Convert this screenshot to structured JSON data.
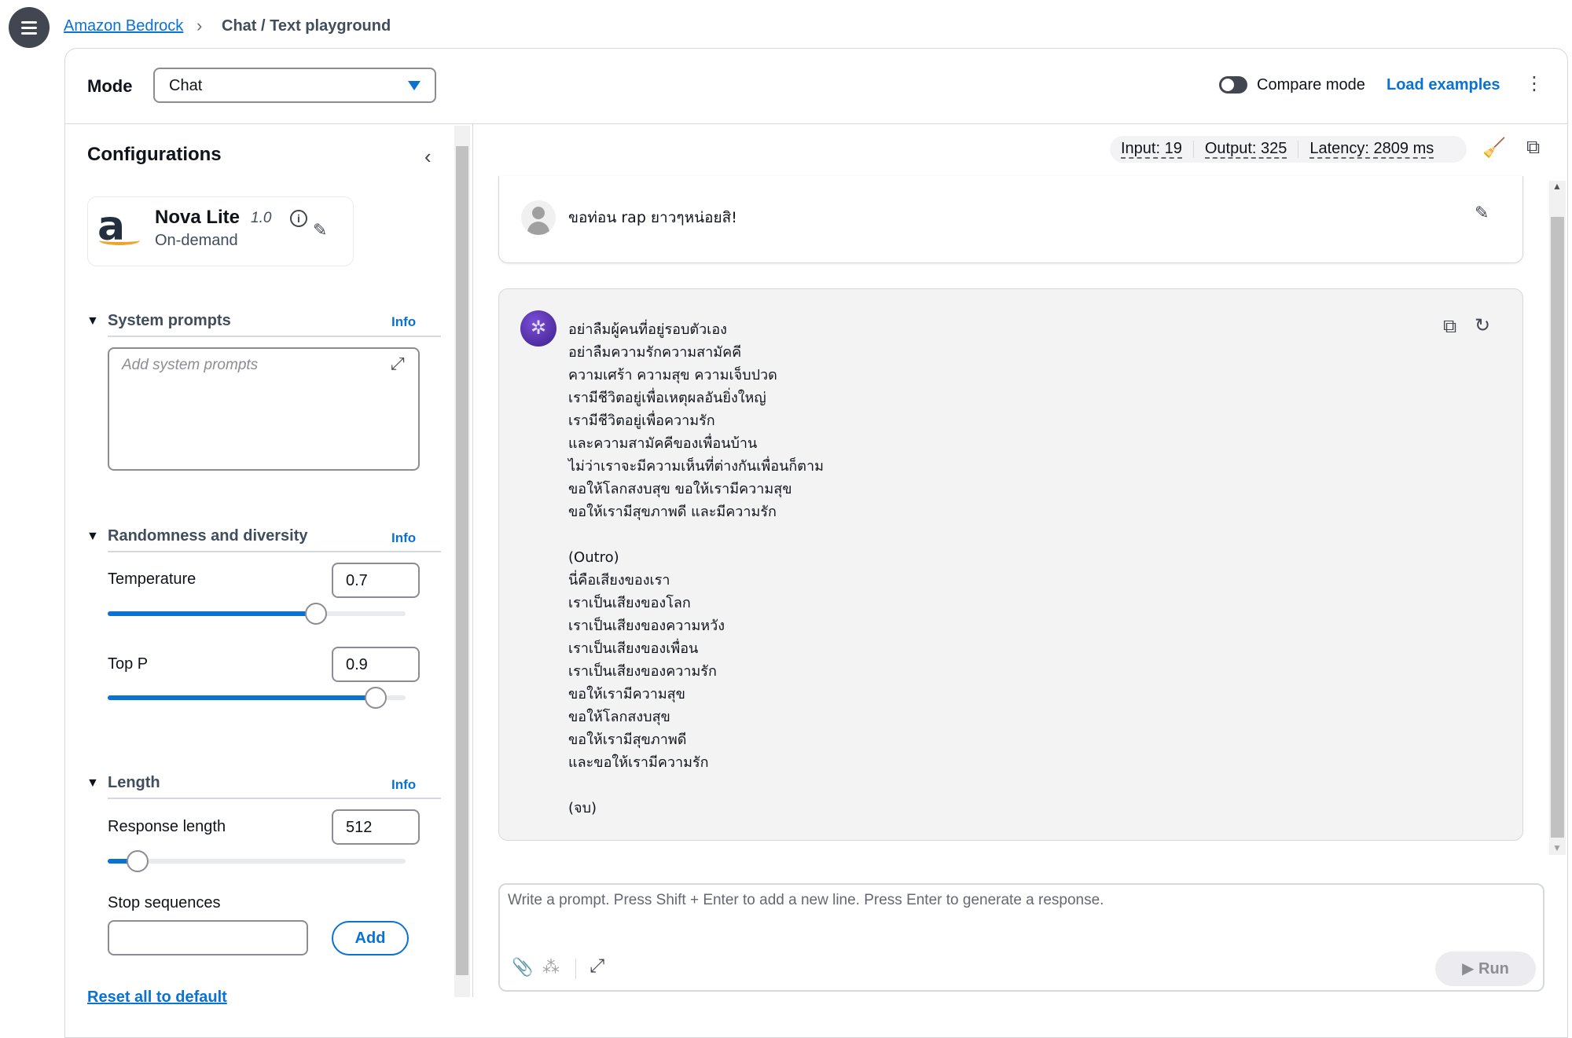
{
  "breadcrumb": {
    "parent": "Amazon Bedrock",
    "current": "Chat / Text playground"
  },
  "header": {
    "mode_label": "Mode",
    "mode_value": "Chat",
    "compare_mode": "Compare mode",
    "compare_enabled": false,
    "load_examples": "Load examples"
  },
  "config": {
    "title": "Configurations",
    "model": {
      "name": "Nova Lite",
      "version": "1.0",
      "type": "On-demand",
      "logo": "a"
    },
    "system_prompts": {
      "title": "System prompts",
      "info": "Info",
      "placeholder": "Add system prompts"
    },
    "randomness": {
      "title": "Randomness and diversity",
      "info": "Info",
      "temperature": {
        "label": "Temperature",
        "value": "0.7",
        "min": 0,
        "max": 1
      },
      "top_p": {
        "label": "Top P",
        "value": "0.9",
        "min": 0,
        "max": 1
      }
    },
    "length": {
      "title": "Length",
      "info": "Info",
      "response_length": {
        "label": "Response length",
        "value": "512",
        "slider_fraction": 0.1
      },
      "stop_sequences": {
        "label": "Stop sequences",
        "value": "",
        "add": "Add"
      }
    },
    "reset": "Reset all to default"
  },
  "metrics": {
    "input": "Input: 19",
    "output": "Output: 325",
    "latency": "Latency: 2809 ms"
  },
  "chat": {
    "user_message": "ขอท่อน rap ยาวๆหน่อยสิ!",
    "assistant_message": "อย่าลืมผู้คนที่อยู่รอบตัวเอง\nอย่าลืมความรักความสามัคคี\nความเศร้า ความสุข ความเจ็บปวด\nเรามีชีวิตอยู่เพื่อเหตุผลอันยิ่งใหญ่\nเรามีชีวิตอยู่เพื่อความรัก\nและความสามัคคีของเพื่อนบ้าน\nไม่ว่าเราจะมีความเห็นที่ต่างกันเพื่อนก็ตาม\nขอให้โลกสงบสุข ขอให้เรามีความสุข\nขอให้เรามีสุขภาพดี และมีความรัก\n\n(Outro)\nนี่คือเสียงของเรา\nเราเป็นเสียงของโลก\nเราเป็นเสียงของความหวัง\nเราเป็นเสียงของเพื่อน\nเราเป็นเสียงของความรัก\nขอให้เรามีความสุข\nขอให้โลกสงบสุข\nขอให้เรามีสุขภาพดี\nและขอให้เรามีความรัก\n\n(จบ)"
  },
  "prompt": {
    "placeholder": "Write a prompt. Press Shift + Enter to add a new line. Press Enter to generate a response.",
    "run": "Run"
  },
  "colors": {
    "accent": "#0972d3",
    "assistant_bg": "#f3f3f3"
  }
}
